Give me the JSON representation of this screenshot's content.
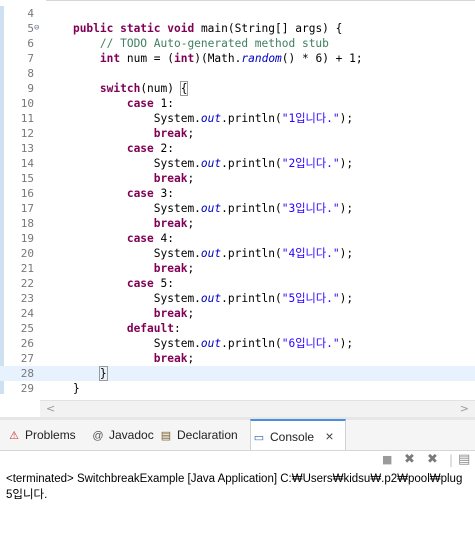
{
  "editor": {
    "lines": [
      {
        "num": "4",
        "fold": "",
        "segments": []
      },
      {
        "num": "5",
        "fold": "⊖",
        "segments": [
          {
            "t": "    "
          },
          {
            "t": "public static void",
            "c": "kw"
          },
          {
            "t": " main(String[] args) {"
          }
        ]
      },
      {
        "num": "6",
        "fold": "",
        "segments": [
          {
            "t": "        "
          },
          {
            "t": "// TODO Auto-generated method stub",
            "c": "cm"
          }
        ]
      },
      {
        "num": "7",
        "fold": "",
        "segments": [
          {
            "t": "        "
          },
          {
            "t": "int",
            "c": "kw"
          },
          {
            "t": " num = ("
          },
          {
            "t": "int",
            "c": "kw"
          },
          {
            "t": ")(Math."
          },
          {
            "t": "random",
            "c": "it"
          },
          {
            "t": "() * 6) + 1;"
          }
        ]
      },
      {
        "num": "8",
        "fold": "",
        "segments": []
      },
      {
        "num": "9",
        "fold": "",
        "segments": [
          {
            "t": "        "
          },
          {
            "t": "switch",
            "c": "kw"
          },
          {
            "t": "(num) "
          },
          {
            "t": "{",
            "c": "bracket"
          }
        ]
      },
      {
        "num": "10",
        "fold": "",
        "segments": [
          {
            "t": "            "
          },
          {
            "t": "case",
            "c": "kw"
          },
          {
            "t": " 1:"
          }
        ]
      },
      {
        "num": "11",
        "fold": "",
        "segments": [
          {
            "t": "                System."
          },
          {
            "t": "out",
            "c": "it"
          },
          {
            "t": ".println("
          },
          {
            "t": "\"1입니다.\"",
            "c": "st"
          },
          {
            "t": ");"
          }
        ]
      },
      {
        "num": "12",
        "fold": "",
        "segments": [
          {
            "t": "                "
          },
          {
            "t": "break",
            "c": "kw"
          },
          {
            "t": ";"
          }
        ]
      },
      {
        "num": "13",
        "fold": "",
        "segments": [
          {
            "t": "            "
          },
          {
            "t": "case",
            "c": "kw"
          },
          {
            "t": " 2:"
          }
        ]
      },
      {
        "num": "14",
        "fold": "",
        "segments": [
          {
            "t": "                System."
          },
          {
            "t": "out",
            "c": "it"
          },
          {
            "t": ".println("
          },
          {
            "t": "\"2입니다.\"",
            "c": "st"
          },
          {
            "t": ");"
          }
        ]
      },
      {
        "num": "15",
        "fold": "",
        "segments": [
          {
            "t": "                "
          },
          {
            "t": "break",
            "c": "kw"
          },
          {
            "t": ";"
          }
        ]
      },
      {
        "num": "16",
        "fold": "",
        "segments": [
          {
            "t": "            "
          },
          {
            "t": "case",
            "c": "kw"
          },
          {
            "t": " 3:"
          }
        ]
      },
      {
        "num": "17",
        "fold": "",
        "segments": [
          {
            "t": "                System."
          },
          {
            "t": "out",
            "c": "it"
          },
          {
            "t": ".println("
          },
          {
            "t": "\"3입니다.\"",
            "c": "st"
          },
          {
            "t": ");"
          }
        ]
      },
      {
        "num": "18",
        "fold": "",
        "segments": [
          {
            "t": "                "
          },
          {
            "t": "break",
            "c": "kw"
          },
          {
            "t": ";"
          }
        ]
      },
      {
        "num": "19",
        "fold": "",
        "segments": [
          {
            "t": "            "
          },
          {
            "t": "case",
            "c": "kw"
          },
          {
            "t": " 4:"
          }
        ]
      },
      {
        "num": "20",
        "fold": "",
        "segments": [
          {
            "t": "                System."
          },
          {
            "t": "out",
            "c": "it"
          },
          {
            "t": ".println("
          },
          {
            "t": "\"4입니다.\"",
            "c": "st"
          },
          {
            "t": ");"
          }
        ]
      },
      {
        "num": "21",
        "fold": "",
        "segments": [
          {
            "t": "                "
          },
          {
            "t": "break",
            "c": "kw"
          },
          {
            "t": ";"
          }
        ]
      },
      {
        "num": "22",
        "fold": "",
        "segments": [
          {
            "t": "            "
          },
          {
            "t": "case",
            "c": "kw"
          },
          {
            "t": " 5:"
          }
        ]
      },
      {
        "num": "23",
        "fold": "",
        "segments": [
          {
            "t": "                System."
          },
          {
            "t": "out",
            "c": "it"
          },
          {
            "t": ".println("
          },
          {
            "t": "\"5입니다.\"",
            "c": "st"
          },
          {
            "t": ");"
          }
        ]
      },
      {
        "num": "24",
        "fold": "",
        "segments": [
          {
            "t": "                "
          },
          {
            "t": "break",
            "c": "kw"
          },
          {
            "t": ";"
          }
        ]
      },
      {
        "num": "25",
        "fold": "",
        "segments": [
          {
            "t": "            "
          },
          {
            "t": "default",
            "c": "kw"
          },
          {
            "t": ":"
          }
        ]
      },
      {
        "num": "26",
        "fold": "",
        "segments": [
          {
            "t": "                System."
          },
          {
            "t": "out",
            "c": "it"
          },
          {
            "t": ".println("
          },
          {
            "t": "\"6입니다.\"",
            "c": "st"
          },
          {
            "t": ");"
          }
        ]
      },
      {
        "num": "27",
        "fold": "",
        "segments": [
          {
            "t": "                "
          },
          {
            "t": "break",
            "c": "kw"
          },
          {
            "t": ";"
          }
        ]
      },
      {
        "num": "28",
        "fold": "",
        "current": true,
        "segments": [
          {
            "t": "        "
          },
          {
            "t": "}",
            "c": "bracket"
          },
          {
            "t": "",
            "c": "caret"
          }
        ]
      },
      {
        "num": "29",
        "fold": "",
        "segments": [
          {
            "t": "    }"
          }
        ]
      }
    ]
  },
  "scrollbar": {
    "left_arrow": "<",
    "right_arrow": ">"
  },
  "tabs": [
    {
      "id": "problems",
      "label": "Problems",
      "icon": "problems-icon",
      "glyph": "⚠"
    },
    {
      "id": "javadoc",
      "label": "Javadoc",
      "icon": "at-icon",
      "glyph": "@"
    },
    {
      "id": "declaration",
      "label": "Declaration",
      "icon": "declaration-icon",
      "glyph": "▤"
    },
    {
      "id": "console",
      "label": "Console",
      "icon": "console-icon",
      "glyph": "▭",
      "active": true,
      "close": "×"
    }
  ],
  "console_toolbar": {
    "buttons": [
      {
        "name": "terminate-icon",
        "glyph": "■"
      },
      {
        "name": "remove-launch-icon",
        "glyph": "✖"
      },
      {
        "name": "remove-all-terminated-icon",
        "glyph": "✖"
      },
      {
        "name": "clear-console-icon",
        "glyph": "▤"
      }
    ]
  },
  "console": {
    "status": "<terminated> SwitchbreakExample [Java Application] C:₩Users₩kidsu₩.p2₩pool₩plug",
    "output": "5입니다."
  },
  "colors": {
    "keyword": "#7f0055",
    "comment": "#3f7f5f",
    "string": "#2a00ff",
    "field": "#0000c0",
    "current_line": "#e8f2fe"
  }
}
